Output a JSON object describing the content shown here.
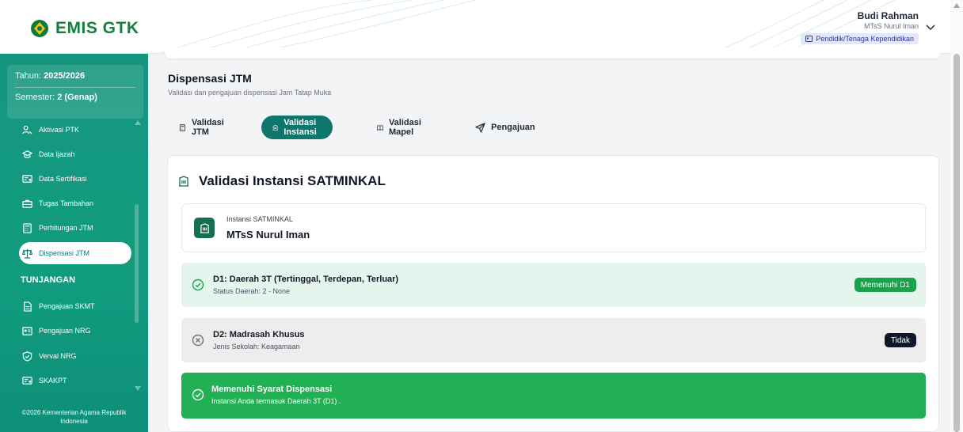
{
  "app": {
    "name": "EMIS GTK",
    "brand_color": "#15803d"
  },
  "user": {
    "name": "Budi Rahman",
    "school": "MTsS Nurul Iman",
    "role": "Pendidik/Tenaga Kependidikan"
  },
  "sidebar": {
    "year_label": "Tahun:",
    "year_value": "2025/2026",
    "semester_label": "Semester:",
    "semester_value": "2 (Genap)",
    "items": [
      {
        "label": "Aktivasi PTK",
        "icon": "user-search-icon"
      },
      {
        "label": "Data Ijazah",
        "icon": "graduation-cap-icon"
      },
      {
        "label": "Data Sertifikasi",
        "icon": "certificate-icon"
      },
      {
        "label": "Tugas Tambahan",
        "icon": "briefcase-icon"
      },
      {
        "label": "Perhitungan JTM",
        "icon": "calculator-icon"
      },
      {
        "label": "Dispensasi JTM",
        "icon": "scale-icon",
        "active": true
      }
    ],
    "section_title": "TUNJANGAN",
    "section_items": [
      {
        "label": "Pengajuan SKMT",
        "icon": "file-icon"
      },
      {
        "label": "Pengajuan NRG",
        "icon": "id-card-icon"
      },
      {
        "label": "Verval NRG",
        "icon": "shield-check-icon"
      },
      {
        "label": "SKAKPT",
        "icon": "certificate-icon"
      }
    ],
    "footer": "©2026 Kementerian Agama Republik Indonesia"
  },
  "page": {
    "title": "Dispensasi JTM",
    "subtitle": "Validasi dan pengajuan dispensasi Jam Tatap Muka",
    "tabs": [
      {
        "label": "Validasi JTM",
        "icon": "calculator-icon"
      },
      {
        "label": "Validasi Instansi",
        "icon": "building-icon",
        "active": true
      },
      {
        "label": "Validasi Mapel",
        "icon": "book-icon"
      },
      {
        "label": "Pengajuan",
        "icon": "send-icon"
      }
    ]
  },
  "card": {
    "title": "Validasi Instansi SATMINKAL",
    "instansi_label": "Instansi SATMINKAL",
    "instansi_value": "MTsS Nurul Iman",
    "requirements": [
      {
        "title": "D1: Daerah 3T (Tertinggal, Terdepan, Terluar)",
        "detail": "Status Daerah: 2 - None",
        "badge": "Memenuhi D1",
        "status": "ok"
      },
      {
        "title": "D2: Madrasah Khusus",
        "detail": "Jenis Sekolah: Keagamaan",
        "badge": "Tidak",
        "status": "no"
      }
    ],
    "result_title": "Memenuhi Syarat Dispensasi",
    "result_detail": "Instansi Anda termasuk Daerah 3T (D1) ."
  }
}
